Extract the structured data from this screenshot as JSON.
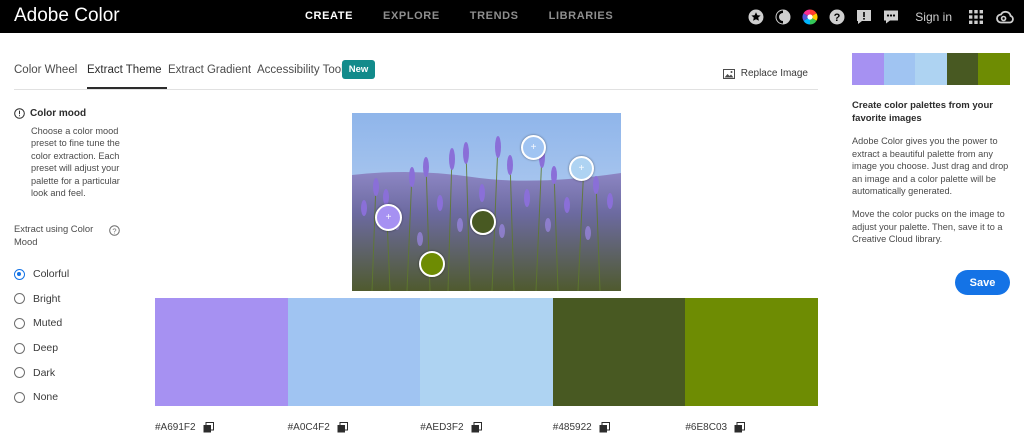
{
  "app": {
    "title": "Adobe Color"
  },
  "topnav": {
    "items": [
      {
        "label": "CREATE",
        "active": true
      },
      {
        "label": "EXPLORE",
        "active": false
      },
      {
        "label": "TRENDS",
        "active": false
      },
      {
        "label": "LIBRARIES",
        "active": false
      }
    ],
    "icons": [
      "star-icon",
      "moon-icon",
      "color-wheel-icon",
      "help-icon",
      "feedback-icon",
      "chat-icon"
    ],
    "signin_label": "Sign in"
  },
  "tabs": {
    "items": [
      "Color Wheel",
      "Extract Theme",
      "Extract Gradient",
      "Accessibility Tools"
    ],
    "active": "Extract Theme",
    "new_badge": "New",
    "replace_image": "Replace Image"
  },
  "left": {
    "mood_heading": "Color mood",
    "mood_description": "Choose a color mood preset to fine tune the color extraction. Each preset will adjust your palette for a particular look and feel.",
    "extract_label": "Extract using Color Mood",
    "moods": [
      {
        "label": "Colorful",
        "checked": true
      },
      {
        "label": "Bright",
        "checked": false
      },
      {
        "label": "Muted",
        "checked": false
      },
      {
        "label": "Deep",
        "checked": false
      },
      {
        "label": "Dark",
        "checked": false
      },
      {
        "label": "None",
        "checked": false
      }
    ]
  },
  "palette": {
    "swatches": [
      {
        "hex": "#A691F2",
        "color": "#A691F2"
      },
      {
        "hex": "#A0C4F2",
        "color": "#A0C4F2"
      },
      {
        "hex": "#AED3F2",
        "color": "#AED3F2"
      },
      {
        "hex": "#485922",
        "color": "#485922"
      },
      {
        "hex": "#6E8C03",
        "color": "#6E8C03"
      }
    ]
  },
  "right": {
    "title": "Create color palettes from your favorite images",
    "paragraph1": "Adobe Color gives you the power to extract a beautiful palette from any image you choose. Just drag and drop an image and a color palette will be automatically generated.",
    "paragraph2": "Move the color pucks on the image to adjust your palette. Then, save it to a Creative Cloud library.",
    "save_label": "Save"
  },
  "colors": {
    "accent": "#1473e6",
    "badge": "#128b8b",
    "topbar": "#000000"
  }
}
